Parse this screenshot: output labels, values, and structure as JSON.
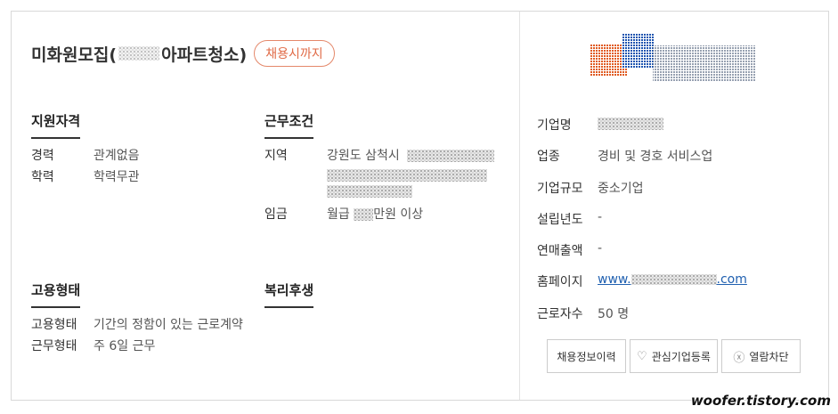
{
  "job": {
    "title_prefix": "미화원모집(",
    "title_suffix": "아파트청소)",
    "deadline_badge": "채용시까지"
  },
  "sections": {
    "qualification": {
      "heading": "지원자격",
      "rows": [
        {
          "label": "경력",
          "value": "관계없음"
        },
        {
          "label": "학력",
          "value": "학력무관"
        }
      ]
    },
    "conditions": {
      "heading": "근무조건",
      "region_label": "지역",
      "region_value": "강원도 삼척시",
      "wage_label": "임금",
      "wage_prefix": "월급",
      "wage_suffix": "만원 이상"
    },
    "employment": {
      "heading": "고용형태",
      "rows": [
        {
          "label": "고용형태",
          "value": "기간의 정함이 있는 근로계약"
        },
        {
          "label": "근무형태",
          "value": "주 6일 근무"
        }
      ]
    },
    "welfare": {
      "heading": "복리후생"
    }
  },
  "company": {
    "name_label": "기업명",
    "industry_label": "업종",
    "industry_value": "경비 및 경호 서비스업",
    "size_label": "기업규모",
    "size_value": "중소기업",
    "founded_label": "설립년도",
    "founded_value": "-",
    "revenue_label": "연매출액",
    "revenue_value": "-",
    "homepage_label": "홈페이지",
    "homepage_prefix": "www.",
    "homepage_suffix": ".com",
    "employees_label": "근로자수",
    "employees_value": "50 명"
  },
  "buttons": {
    "history": "채용정보이력",
    "interest": "관심기업등록",
    "block": "열람차단"
  },
  "watermark": "woofer.tistory.com",
  "colors": {
    "badge_border": "#e4886a",
    "badge_text": "#e06a46",
    "link": "#2060b0"
  }
}
